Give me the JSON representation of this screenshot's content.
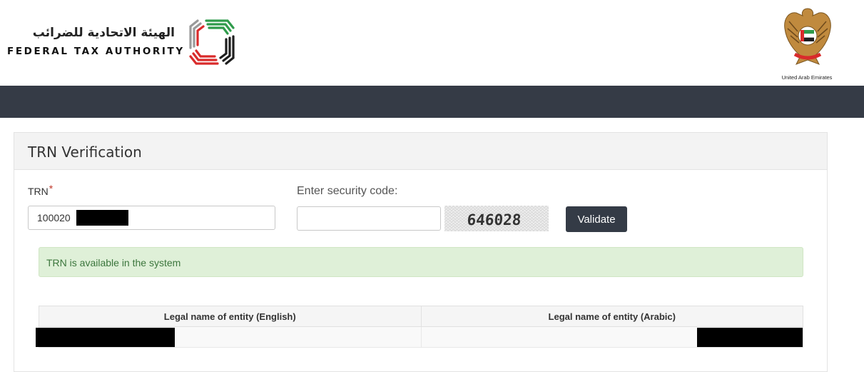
{
  "header": {
    "logo_arabic": "الهيئة الاتحادية للضرائب",
    "logo_english": "FEDERAL TAX AUTHORITY",
    "emblem_caption": "United Arab Emirates"
  },
  "panel": {
    "title": "TRN Verification",
    "trn_label": "TRN",
    "required_mark": "*",
    "trn_value": "100020",
    "security_label": "Enter security code:",
    "security_value": "",
    "captcha_text": "646028",
    "validate_label": "Validate"
  },
  "alert": {
    "message": "TRN is available in the system"
  },
  "results_table": {
    "headers": [
      "Legal name of entity (English)",
      "Legal name of entity (Arabic)"
    ]
  },
  "colors": {
    "navbar": "#353b46",
    "button": "#343b46",
    "alert_bg": "#dff0d8",
    "alert_text": "#3c763d",
    "required": "#c0392b"
  }
}
